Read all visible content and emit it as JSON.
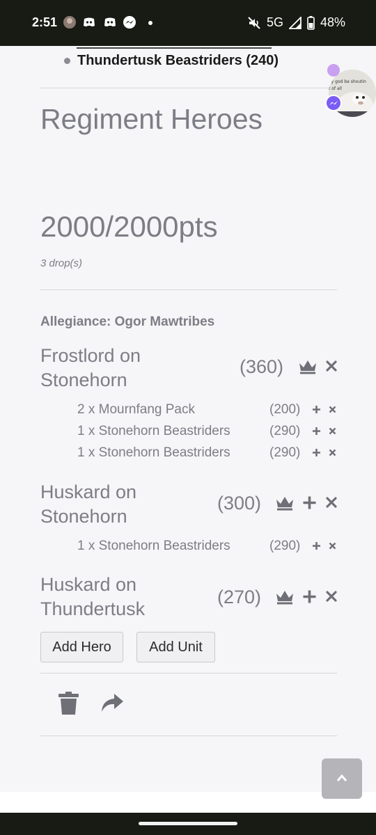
{
  "status_bar": {
    "time": "2:51",
    "network": "5G",
    "battery": "48%",
    "icons": [
      "avatar-icon",
      "discord-icon",
      "discord-icon",
      "messenger-icon",
      "dot-icon",
      "mute-icon",
      "signal-icon",
      "battery-icon"
    ]
  },
  "list": {
    "last_item": "Thundertusk Beastriders (240)"
  },
  "section": {
    "title": "Regiment Heroes"
  },
  "summary": {
    "points": "2000/2000pts",
    "drops": "3 drop(s)",
    "allegiance": "Allegiance: Ogor Mawtribes"
  },
  "heroes": [
    {
      "name": "Frostlord on Stonehorn",
      "points": "(360)",
      "units": [
        {
          "name": "2 x Mournfang Pack",
          "points": "(200)"
        },
        {
          "name": "1 x Stonehorn Beastriders",
          "points": "(290)"
        },
        {
          "name": "1 x Stonehorn Beastriders",
          "points": "(290)"
        }
      ]
    },
    {
      "name": "Huskard on Stonehorn",
      "points": "(300)",
      "units": [
        {
          "name": "1 x Stonehorn Beastriders",
          "points": "(290)"
        }
      ]
    },
    {
      "name": "Huskard on Thundertusk",
      "points": "(270)",
      "units": []
    }
  ],
  "buttons": {
    "add_hero": "Add Hero",
    "add_unit": "Add Unit"
  },
  "chat_head": {
    "caption_line1": "oy god ba shoutin",
    "caption_line2": "t of all"
  },
  "colors": {
    "text_muted": "#7d7d85",
    "icon": "#6f6f77",
    "background": "#f6f6f8",
    "status_bar": "#181a14",
    "scroll_button": "#b4b4b9"
  }
}
